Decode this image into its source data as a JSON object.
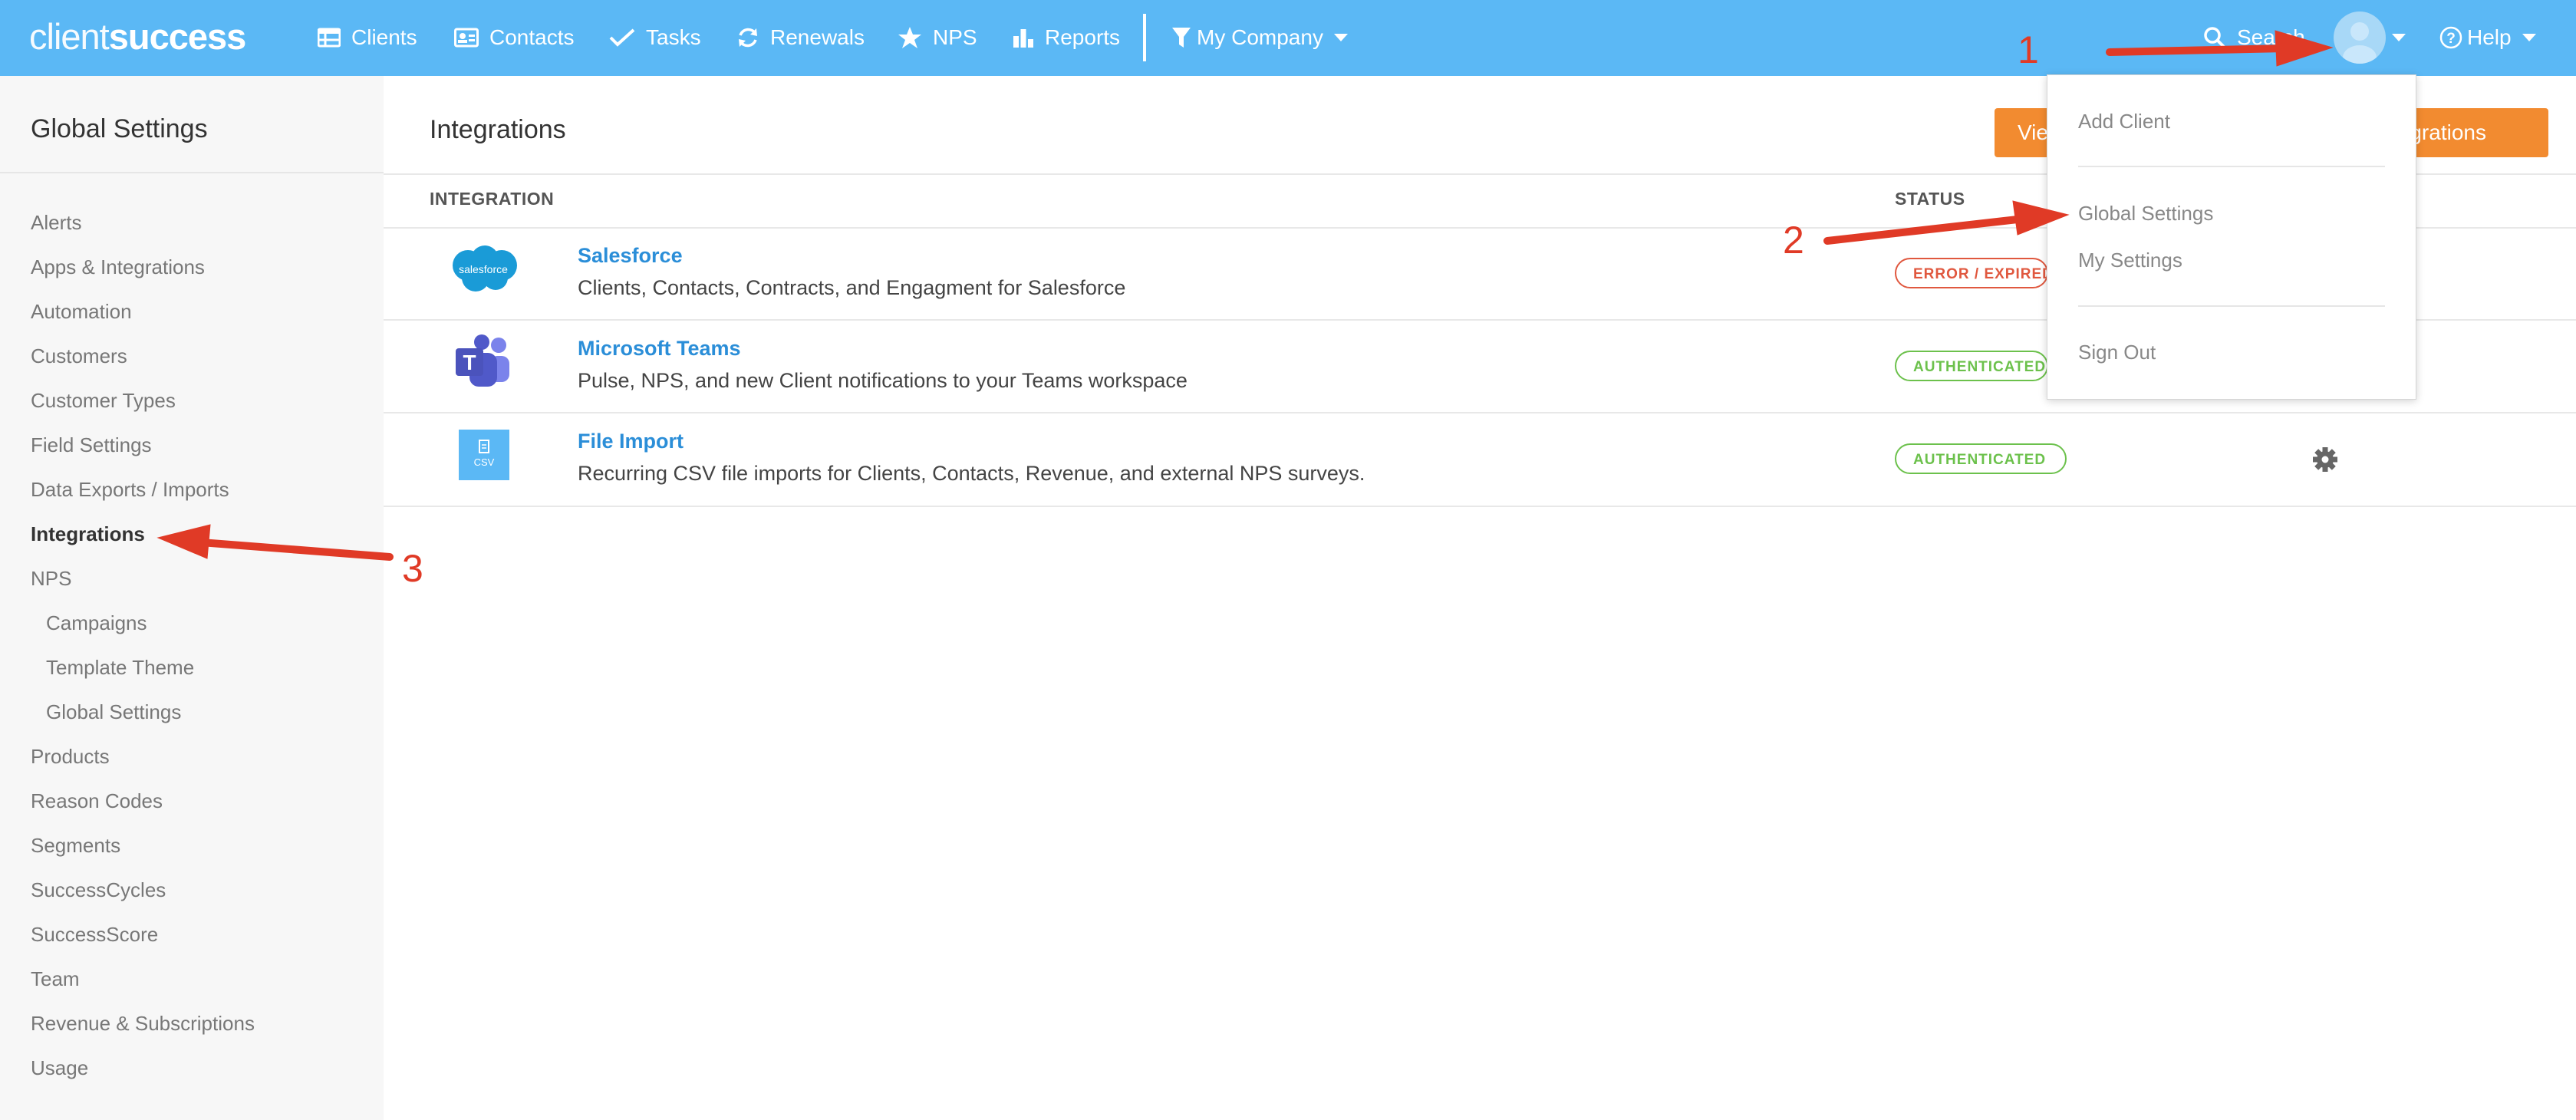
{
  "app": {
    "logo_light": "client",
    "logo_bold": "success"
  },
  "nav": {
    "clients": "Clients",
    "contacts": "Contacts",
    "tasks": "Tasks",
    "renewals": "Renewals",
    "nps": "NPS",
    "reports": "Reports",
    "company_filter": "My Company",
    "search": "Search",
    "help": "Help"
  },
  "sidebar": {
    "title": "Global Settings",
    "items": [
      {
        "label": "Alerts"
      },
      {
        "label": "Apps & Integrations"
      },
      {
        "label": "Automation"
      },
      {
        "label": "Customers"
      },
      {
        "label": "Customer Types"
      },
      {
        "label": "Field Settings"
      },
      {
        "label": "Data Exports / Imports"
      },
      {
        "label": "Integrations"
      },
      {
        "label": "NPS"
      },
      {
        "label": "Campaigns"
      },
      {
        "label": "Template Theme"
      },
      {
        "label": "Global Settings"
      },
      {
        "label": "Products"
      },
      {
        "label": "Reason Codes"
      },
      {
        "label": "Segments"
      },
      {
        "label": "SuccessCycles"
      },
      {
        "label": "SuccessScore"
      },
      {
        "label": "Team"
      },
      {
        "label": "Revenue & Subscriptions"
      },
      {
        "label": "Usage"
      }
    ]
  },
  "main": {
    "title": "Integrations",
    "button_left": "Vie",
    "button_right": "tegrations",
    "columns": {
      "integration": "INTEGRATION",
      "status": "STATUS"
    },
    "rows": [
      {
        "name": "Salesforce",
        "description": "Clients, Contacts, Contracts, and Engagment for Salesforce",
        "status": "ERROR / EXPIRED",
        "logo_text": "salesforce"
      },
      {
        "name": "Microsoft Teams",
        "description": "Pulse, NPS, and new Client notifications to your Teams workspace",
        "status": "AUTHENTICATED",
        "logo_text": "T"
      },
      {
        "name": "File Import",
        "description": "Recurring CSV file imports for Clients, Contacts, Revenue, and external NPS surveys.",
        "status": "AUTHENTICATED",
        "logo_text": "CSV"
      }
    ]
  },
  "dropdown": {
    "add_client": "Add Client",
    "global_settings": "Global Settings",
    "my_settings": "My Settings",
    "sign_out": "Sign Out"
  },
  "annotations": {
    "step1": "1",
    "step2": "2",
    "step3": "3"
  },
  "colors": {
    "nav_bg": "#5bb8f5",
    "accent_orange": "#f28b30",
    "link_blue": "#2b8ed8",
    "error_red": "#e0583f",
    "ok_green": "#6cc14c",
    "annotation_red": "#e03a26"
  }
}
